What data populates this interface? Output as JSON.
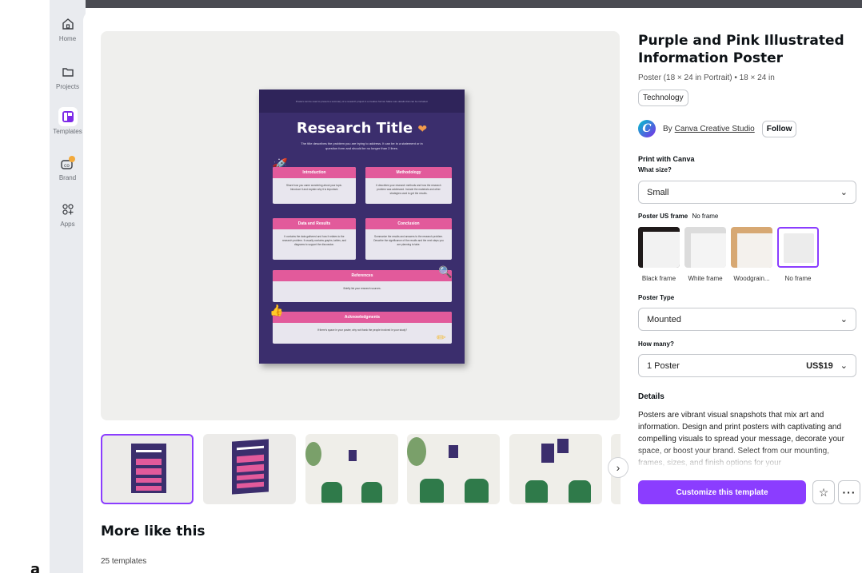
{
  "left_letter": "a",
  "sidebar": {
    "items": [
      {
        "label": "Home",
        "icon": "home-icon"
      },
      {
        "label": "Projects",
        "icon": "folder-icon"
      },
      {
        "label": "Templates",
        "icon": "templates-icon"
      },
      {
        "label": "Brand",
        "icon": "brand-icon"
      },
      {
        "label": "Apps",
        "icon": "apps-icon"
      }
    ]
  },
  "poster": {
    "top_strip": "Posters can be used to present a summary of a research project in a creative format. Make sure details that can be included.",
    "title": "Research Title",
    "subtitle": "The title describes the problem you are trying to address. It can be in a statement or in question form and should be no longer than 2 lines.",
    "sections": [
      {
        "heading": "Introduction",
        "body": "Share how you came wondering about your topic. Introduce it and explain why it is important."
      },
      {
        "heading": "Methodology",
        "body": "It describes your research methods and how the research problem was addressed. Include the materials and other strategies used to get the results."
      },
      {
        "heading": "Data and Results",
        "body": "It contains the data gathered and how it relates to the research problem. It usually contains graphs, tables, and diagrams to support the discussion."
      },
      {
        "heading": "Conclusion",
        "body": "Summarize the results and answers to the research problem. Describe the significance of the results and the next steps you are planning to take."
      },
      {
        "heading": "References",
        "body": "Briefly list your research sources."
      },
      {
        "heading": "Acknowledgments",
        "body": "If there's space in your poster, why not thank the people involved in your study?"
      }
    ]
  },
  "product": {
    "title": "Purple and Pink Illustrated Information Poster",
    "meta": "Poster (18 × 24 in Portrait) • 18 × 24 in",
    "tag": "Technology",
    "by_prefix": "By",
    "creator": "Canva Creative Studio",
    "follow_label": "Follow"
  },
  "print": {
    "heading": "Print with Canva",
    "size_label": "What size?",
    "size_value": "Small",
    "frame_label": "Poster US frame",
    "frame_value": "No frame",
    "frames": [
      "Black frame",
      "White frame",
      "Woodgrain...",
      "No frame"
    ],
    "type_label": "Poster Type",
    "type_value": "Mounted",
    "qty_label": "How many?",
    "qty_value": "1 Poster",
    "price": "US$19"
  },
  "details": {
    "heading": "Details",
    "text": "Posters are vibrant visual snapshots that mix art and information. Design and print posters with captivating and compelling visuals to spread your message, decorate your space, or boost your brand. Select from our mounting, frames, sizes, and finish options for your"
  },
  "actions": {
    "customize_label": "Customize this template",
    "star_icon": "star-icon",
    "more_icon": "more-icon"
  },
  "more": {
    "title": "More like this",
    "count": "25 templates"
  },
  "colors": {
    "accent": "#8b3dff",
    "poster_bg": "#3b2e6d",
    "poster_pink": "#e25a9b"
  }
}
